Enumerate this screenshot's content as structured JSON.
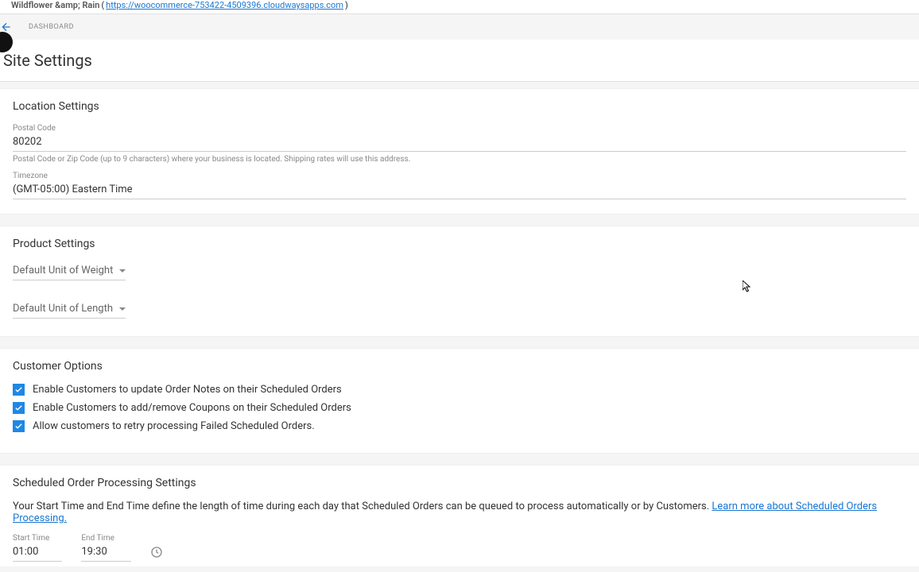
{
  "topbar": {
    "site_name": "Wildflower &amp; Rain",
    "url_open": " (",
    "url": "https://woocommerce-753422-4509396.cloudwaysapps.com",
    "url_close": ")"
  },
  "header": {
    "breadcrumb": "DASHBOARD",
    "page_title": "Site Settings"
  },
  "location": {
    "title": "Location Settings",
    "postal_label": "Postal Code",
    "postal_value": "80202",
    "postal_hint": "Postal Code or Zip Code (up to 9 characters) where your business is located. Shipping rates will use this address.",
    "timezone_label": "Timezone",
    "timezone_value": "(GMT-05:00) Eastern Time"
  },
  "product": {
    "title": "Product Settings",
    "weight_label": "Default Unit of Weight",
    "length_label": "Default Unit of Length"
  },
  "customer": {
    "title": "Customer Options",
    "opt1": "Enable Customers to update Order Notes on their Scheduled Orders",
    "opt2": "Enable Customers to add/remove Coupons on their Scheduled Orders",
    "opt3": "Allow customers to retry processing Failed Scheduled Orders."
  },
  "scheduled": {
    "title": "Scheduled Order Processing Settings",
    "desc_prefix": "Your Start Time and End Time define the length of time during each day that Scheduled Orders can be queued to process automatically or by Customers. ",
    "desc_link": "Learn more about Scheduled Orders Processing.",
    "start_label": "Start Time",
    "start_value": "01:00",
    "end_label": "End Time",
    "end_value": "19:30"
  }
}
